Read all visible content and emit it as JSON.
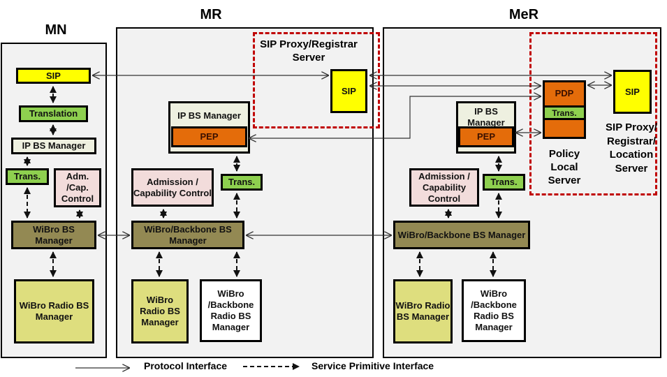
{
  "zones": {
    "mn": {
      "title": "MN"
    },
    "mr": {
      "title": "MR"
    },
    "mer": {
      "title": "MeR"
    }
  },
  "mn": {
    "sip": "SIP",
    "translation": "Translation",
    "ip_bs_manager": "IP BS Manager",
    "trans": "Trans.",
    "adm_cap_control": "Adm. /Cap. Control",
    "wibro_bs_manager": "WiBro BS Manager",
    "wibro_radio_bs_manager": "WiBro Radio BS Manager"
  },
  "mr": {
    "sip_proxy_label": "SIP Proxy/Registrar Server",
    "sip": "SIP",
    "ip_bs_manager": "IP BS Manager",
    "pep": "PEP",
    "admission_control": "Admission / Capability Control",
    "trans": "Trans.",
    "backbone_bs_manager": "WiBro/Backbone BS Manager",
    "wibro_radio_bs_manager": "WiBro Radio BS Manager",
    "backbone_radio_bs_manager": "WiBro /Backbone Radio BS Manager"
  },
  "mer": {
    "ip_bs_manager": "IP BS Manager",
    "pep": "PEP",
    "pdp": "PDP",
    "pdp_trans": "Trans.",
    "sip": "SIP",
    "policy_server_label": "Policy Local Server",
    "sip_server_label": "SIP Proxy/ Registrar/ Location Server",
    "admission_control": "Admission / Capability Control",
    "trans": "Trans.",
    "backbone_bs_manager": "WiBro/Backbone BS Manager",
    "wibro_radio_bs_manager": "WiBro Radio BS Manager",
    "backbone_radio_bs_manager": "WiBro /Backbone Radio BS Manager"
  },
  "legend": {
    "protocol_interface": "Protocol Interface",
    "service_primitive_interface": "Service Primitive Interface"
  },
  "colors": {
    "sip": "#ffff00",
    "trans": "#8ed04f",
    "pep": "#e46c0a",
    "bs_manager": "#938953",
    "radio_bs": "#dede7e",
    "admission": "#f2dcdb",
    "server_boundary": "#c00000"
  }
}
